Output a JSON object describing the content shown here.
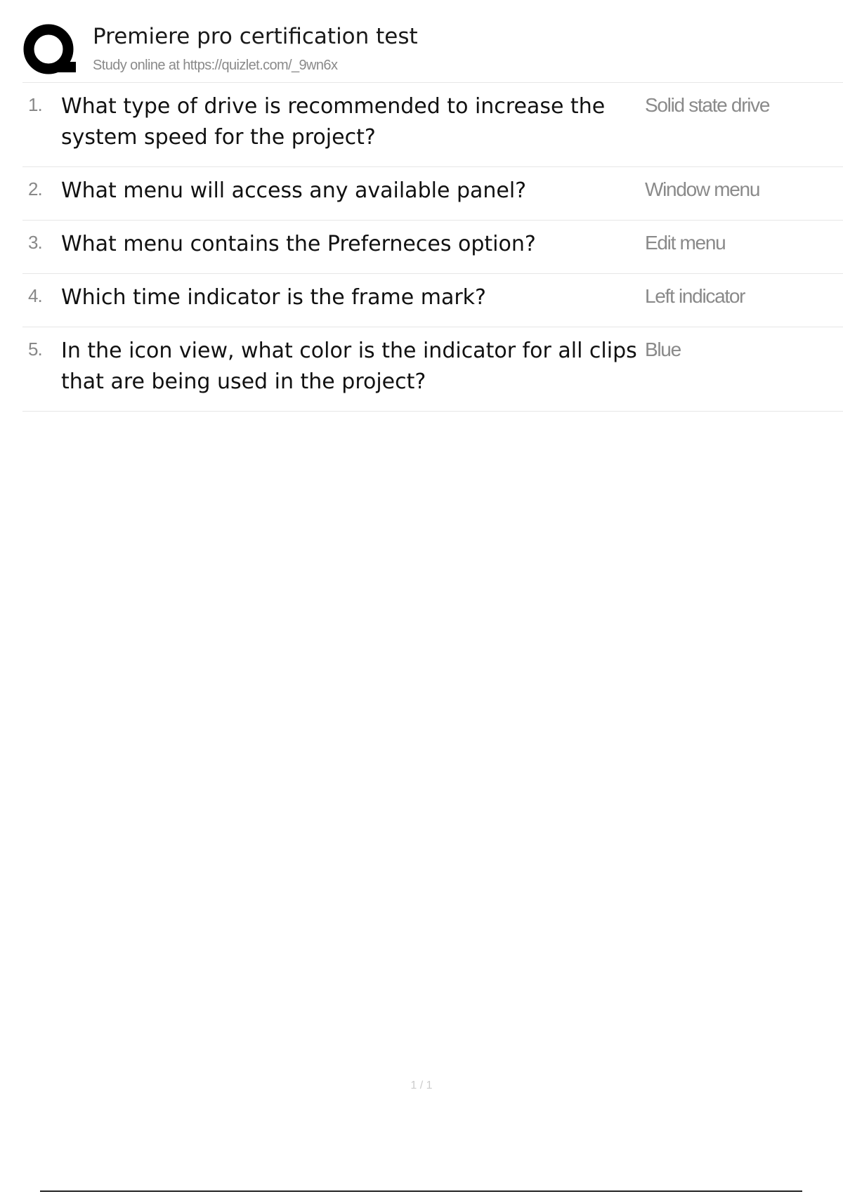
{
  "header": {
    "logo_icon": "quizlet-q-logo",
    "title": "Premiere pro certification test",
    "subtitle": "Study online at https://quizlet.com/_9wn6x"
  },
  "questions": [
    {
      "number": "1.",
      "question": "What type of drive is recommended to increase the system speed for the project?",
      "answer": "Solid state drive"
    },
    {
      "number": "2.",
      "question": "What menu will access any available panel?",
      "answer": "Window menu"
    },
    {
      "number": "3.",
      "question": "What menu contains the Preferneces option?",
      "answer": "Edit menu"
    },
    {
      "number": "4.",
      "question": "Which time indicator is the frame mark?",
      "answer": "Left indicator"
    },
    {
      "number": "5.",
      "question": "In the icon view, what color is the indicator for all clips that are being used in the project?",
      "answer": "Blue"
    }
  ],
  "footer": {
    "page_number": "1 / 1"
  }
}
